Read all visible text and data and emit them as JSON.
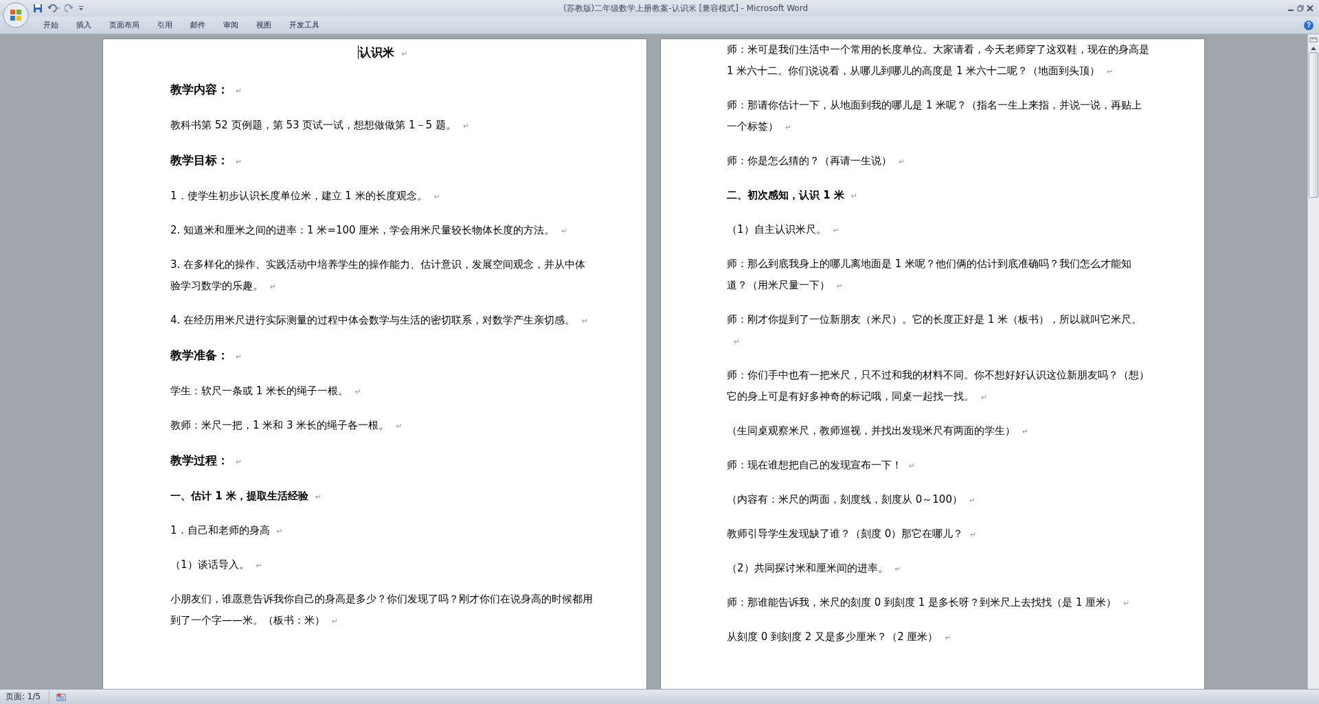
{
  "window": {
    "title": "(苏教版)二年级数学上册教案-认识米 [兼容模式] - Microsoft Word"
  },
  "ribbon": {
    "tabs": [
      {
        "label": "开始"
      },
      {
        "label": "插入"
      },
      {
        "label": "页面布局"
      },
      {
        "label": "引用"
      },
      {
        "label": "邮件"
      },
      {
        "label": "审阅"
      },
      {
        "label": "视图"
      },
      {
        "label": "开发工具"
      }
    ],
    "help": "?"
  },
  "document": {
    "paragraph_mark": "↵",
    "pages": [
      {
        "paragraphs": [
          {
            "kind": "title",
            "text": "认识米",
            "cursor": true
          },
          {
            "kind": "heading",
            "text": "教学内容：",
            "cursor": false
          },
          {
            "kind": "body",
            "text": "教科书第 52 页例题，第 53 页试一试，想想做做第 1－5 题。",
            "cursor": false
          },
          {
            "kind": "heading",
            "text": "教学目标：",
            "cursor": false
          },
          {
            "kind": "body",
            "text": "1．使学生初步认识长度单位米，建立 1 米的长度观念。",
            "cursor": false
          },
          {
            "kind": "body",
            "text": "2. 知道米和厘米之间的进率：1 米=100 厘米，学会用米尺量较长物体长度的方法。",
            "cursor": false
          },
          {
            "kind": "body",
            "text": "3. 在多样化的操作、实践活动中培养学生的操作能力、估计意识，发展空间观念，并从中体验学习数学的乐趣。",
            "cursor": false
          },
          {
            "kind": "body",
            "text": "4.  在经历用米尺进行实际测量的过程中体会数学与生活的密切联系，对数学产生亲切感。",
            "cursor": false
          },
          {
            "kind": "heading",
            "text": "教学准备：",
            "cursor": false
          },
          {
            "kind": "body",
            "text": "学生：软尺一条或 1 米长的绳子一根。",
            "cursor": false
          },
          {
            "kind": "body",
            "text": "教师：米尺一把，1 米和 3 米长的绳子各一根。",
            "cursor": false
          },
          {
            "kind": "heading",
            "text": "教学过程：",
            "cursor": false
          },
          {
            "kind": "section",
            "text": "一、估计 1 米，提取生活经验",
            "cursor": false
          },
          {
            "kind": "body",
            "text": "1．自己和老师的身高",
            "cursor": false
          },
          {
            "kind": "body",
            "text": "（1）谈话导入。",
            "cursor": false
          },
          {
            "kind": "body",
            "text": "小朋友们，谁愿意告诉我你自己的身高是多少？你们发现了吗？刚才你们在说身高的时候都用到了一个字——米。（板书：米）",
            "cursor": false
          }
        ]
      },
      {
        "paragraphs": [
          {
            "kind": "body",
            "text": "师：米可是我们生活中一个常用的长度单位。大家请看，今天老师穿了这双鞋，现在的身高是 1 米六十二。你们说说看，从哪儿到哪儿的高度是 1 米六十二呢？（地面到头顶）",
            "cursor": false
          },
          {
            "kind": "body",
            "text": "师：那请你估计一下，从地面到我的哪儿是 1 米呢？（指名一生上来指，并说一说，再贴上一个标签）",
            "cursor": false
          },
          {
            "kind": "body",
            "text": "师：你是怎么猜的？（再请一生说）",
            "cursor": false
          },
          {
            "kind": "section",
            "text": "二、初次感知，认识 1 米",
            "cursor": false
          },
          {
            "kind": "body",
            "text": "（1）自主认识米尺。",
            "cursor": false
          },
          {
            "kind": "body",
            "text": "师：那么到底我身上的哪儿离地面是 1 米呢？他们俩的估计到底准确吗？我们怎么才能知道？（用米尺量一下）",
            "cursor": false
          },
          {
            "kind": "body",
            "text": "师：刚才你提到了一位新朋友（米尺）。它的长度正好是 1 米（板书），所以就叫它米尺。",
            "cursor": false
          },
          {
            "kind": "body",
            "text": "师：你们手中也有一把米尺，只不过和我的材料不同。你不想好好认识这位新朋友吗？（想）它的身上可是有好多神奇的标记哦，同桌一起找一找。",
            "cursor": false
          },
          {
            "kind": "body",
            "text": "（生同桌观察米尺，教师巡视，并找出发现米尺有两面的学生）",
            "cursor": false
          },
          {
            "kind": "body",
            "text": "师：现在谁想把自己的发现宣布一下！",
            "cursor": false
          },
          {
            "kind": "body",
            "text": "（内容有：米尺的两面，刻度线，刻度从 0～100）",
            "cursor": false
          },
          {
            "kind": "body",
            "text": "教师引导学生发现缺了谁？（刻度 0）那它在哪儿？",
            "cursor": false
          },
          {
            "kind": "body",
            "text": "（2）共同探讨米和厘米间的进率。",
            "cursor": false
          },
          {
            "kind": "body",
            "text": "师：那谁能告诉我，米尺的刻度 0 到刻度 1 是多长呀？到米尺上去找找（是 1 厘米）",
            "cursor": false
          },
          {
            "kind": "body",
            "text": "从刻度 0 到刻度 2 又是多少厘米？（2 厘米）",
            "cursor": false
          }
        ]
      }
    ]
  },
  "status_bar": {
    "page": "页面: 1/5"
  }
}
